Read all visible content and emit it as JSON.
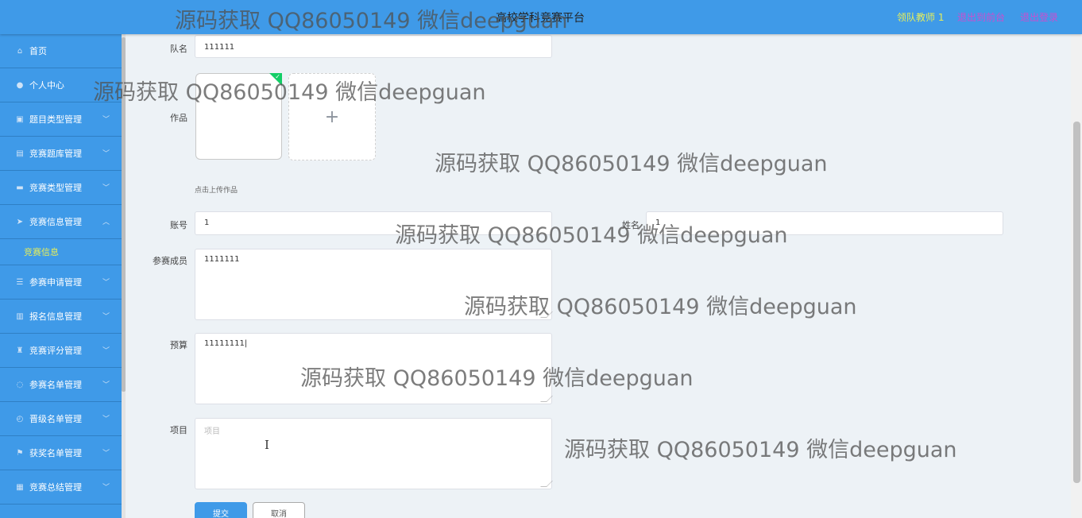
{
  "header": {
    "title": "高校学科竞赛平台",
    "user": "领队教师 1",
    "back_to_front": "退出到前台",
    "logout": "退出登录"
  },
  "sidebar": {
    "items": [
      {
        "label": "首页",
        "icon": "home-icon"
      },
      {
        "label": "个人中心",
        "icon": "user-icon"
      },
      {
        "label": "题目类型管理",
        "icon": "clipboard-icon"
      },
      {
        "label": "竞赛题库管理",
        "icon": "database-icon"
      },
      {
        "label": "竞赛类型管理",
        "icon": "monitor-icon"
      },
      {
        "label": "竞赛信息管理",
        "icon": "send-icon"
      },
      {
        "label": "参赛申请管理",
        "icon": "list-icon"
      },
      {
        "label": "报名信息管理",
        "icon": "book-icon"
      },
      {
        "label": "竞赛评分管理",
        "icon": "trophy-icon"
      },
      {
        "label": "参赛名单管理",
        "icon": "loading-icon"
      },
      {
        "label": "晋级名单管理",
        "icon": "clock-icon"
      },
      {
        "label": "获奖名单管理",
        "icon": "flag-icon"
      },
      {
        "label": "竞赛总结管理",
        "icon": "document-icon"
      }
    ],
    "sub_item": "竞赛信息"
  },
  "form": {
    "team_name_label": "队名",
    "team_name_value": "111111",
    "work_label": "作品",
    "upload_plus": "+",
    "upload_tip": "点击上传作品",
    "account_label": "账号",
    "account_value": "1",
    "name_label": "姓名",
    "name_value": "1",
    "members_label": "参赛成员",
    "members_value": "1111111",
    "budget_label": "预算",
    "budget_value": "11111111",
    "project_label": "项目",
    "project_placeholder": "项目",
    "submit": "提交",
    "cancel": "取消"
  },
  "watermark": "源码获取 QQ86050149 微信deepguan"
}
